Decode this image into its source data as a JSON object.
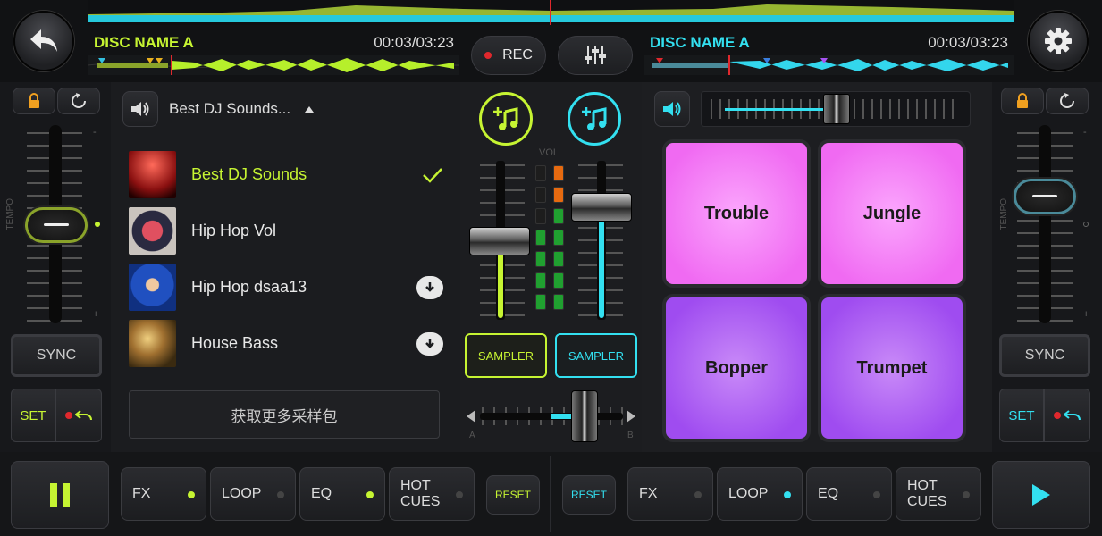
{
  "deckA": {
    "disc_name": "DISC NAME A",
    "time": "00:03/03:23",
    "sync_label": "SYNC",
    "set_label": "SET",
    "tempo_label": "TEMPO",
    "tempo_minus": "-",
    "tempo_plus": "+"
  },
  "deckB": {
    "disc_name": "DISC NAME A",
    "time": "00:03/03:23",
    "sync_label": "SYNC",
    "set_label": "SET",
    "tempo_label": "TEMPO",
    "tempo_minus": "-",
    "tempo_plus": "+"
  },
  "center": {
    "rec_label": "REC",
    "vol_label": "VOL",
    "sampler_left": "SAMPLER",
    "sampler_right": "SAMPLER",
    "cross_a": "A",
    "cross_b": "B"
  },
  "library": {
    "selected_pack": "Best DJ Sounds...",
    "items": [
      {
        "name": "Best DJ Sounds",
        "status": "selected"
      },
      {
        "name": "Hip Hop Vol",
        "status": "none"
      },
      {
        "name": "Hip Hop dsaa13",
        "status": "download"
      },
      {
        "name": "House Bass",
        "status": "download"
      }
    ],
    "more_button": "获取更多采样包"
  },
  "pads": [
    "Trouble",
    "Jungle",
    "Bopper",
    "Trumpet"
  ],
  "bottom_left": {
    "fx": "FX",
    "loop": "LOOP",
    "eq": "EQ",
    "hot_cues_1": "HOT",
    "hot_cues_2": "CUES",
    "reset": "RESET"
  },
  "bottom_right": {
    "fx": "FX",
    "loop": "LOOP",
    "eq": "EQ",
    "hot_cues_1": "HOT",
    "hot_cues_2": "CUES",
    "reset": "RESET"
  },
  "colors": {
    "green": "#c6f432",
    "cyan": "#33e0f0",
    "pink": "#f47af7",
    "purple": "#a653f2",
    "red": "#e0282d"
  }
}
